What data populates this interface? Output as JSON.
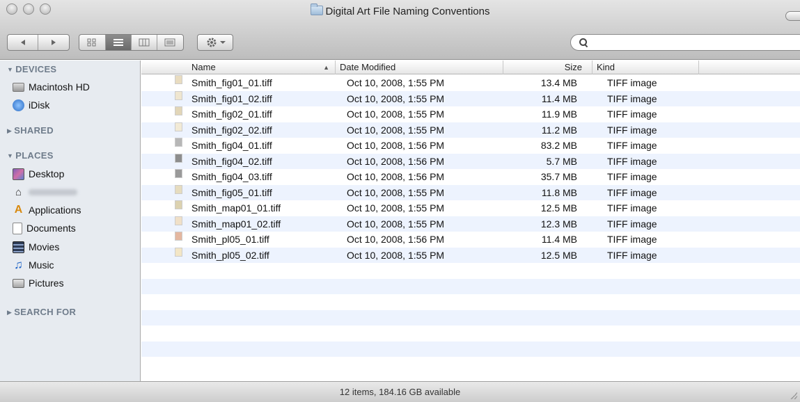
{
  "window": {
    "title": "Digital Art File Naming Conventions"
  },
  "search": {
    "value": ""
  },
  "sidebar": {
    "devices": {
      "label": "DEVICES",
      "items": [
        {
          "label": "Macintosh HD",
          "icon": "hard-drive-icon"
        },
        {
          "label": "iDisk",
          "icon": "idisk-icon"
        }
      ]
    },
    "shared": {
      "label": "SHARED"
    },
    "places": {
      "label": "PLACES",
      "items": [
        {
          "label": "Desktop",
          "icon": "desktop-icon"
        },
        {
          "label": "",
          "icon": "home-icon"
        },
        {
          "label": "Applications",
          "icon": "applications-icon"
        },
        {
          "label": "Documents",
          "icon": "documents-icon"
        },
        {
          "label": "Movies",
          "icon": "movies-icon"
        },
        {
          "label": "Music",
          "icon": "music-icon"
        },
        {
          "label": "Pictures",
          "icon": "pictures-icon"
        }
      ]
    },
    "search_for": {
      "label": "SEARCH FOR"
    }
  },
  "columns": {
    "name": "Name",
    "date": "Date Modified",
    "size": "Size",
    "kind": "Kind"
  },
  "files": [
    {
      "name": "Smith_fig01_01.tiff",
      "date": "Oct 10, 2008, 1:55 PM",
      "size": "13.4 MB",
      "kind": "TIFF image"
    },
    {
      "name": "Smith_fig01_02.tiff",
      "date": "Oct 10, 2008, 1:55 PM",
      "size": "11.4 MB",
      "kind": "TIFF image"
    },
    {
      "name": "Smith_fig02_01.tiff",
      "date": "Oct 10, 2008, 1:55 PM",
      "size": "11.9 MB",
      "kind": "TIFF image"
    },
    {
      "name": "Smith_fig02_02.tiff",
      "date": "Oct 10, 2008, 1:55 PM",
      "size": "11.2 MB",
      "kind": "TIFF image"
    },
    {
      "name": "Smith_fig04_01.tiff",
      "date": "Oct 10, 2008, 1:56 PM",
      "size": "83.2 MB",
      "kind": "TIFF image"
    },
    {
      "name": "Smith_fig04_02.tiff",
      "date": "Oct 10, 2008, 1:56 PM",
      "size": "5.7 MB",
      "kind": "TIFF image"
    },
    {
      "name": "Smith_fig04_03.tiff",
      "date": "Oct 10, 2008, 1:56 PM",
      "size": "35.7 MB",
      "kind": "TIFF image"
    },
    {
      "name": "Smith_fig05_01.tiff",
      "date": "Oct 10, 2008, 1:55 PM",
      "size": "11.8 MB",
      "kind": "TIFF image"
    },
    {
      "name": "Smith_map01_01.tiff",
      "date": "Oct 10, 2008, 1:55 PM",
      "size": "12.5 MB",
      "kind": "TIFF image"
    },
    {
      "name": "Smith_map01_02.tiff",
      "date": "Oct 10, 2008, 1:55 PM",
      "size": "12.3 MB",
      "kind": "TIFF image"
    },
    {
      "name": "Smith_pl05_01.tiff",
      "date": "Oct 10, 2008, 1:56 PM",
      "size": "11.4 MB",
      "kind": "TIFF image"
    },
    {
      "name": "Smith_pl05_02.tiff",
      "date": "Oct 10, 2008, 1:55 PM",
      "size": "12.5 MB",
      "kind": "TIFF image"
    }
  ],
  "status": {
    "text": "12 items, 184.16 GB available"
  }
}
